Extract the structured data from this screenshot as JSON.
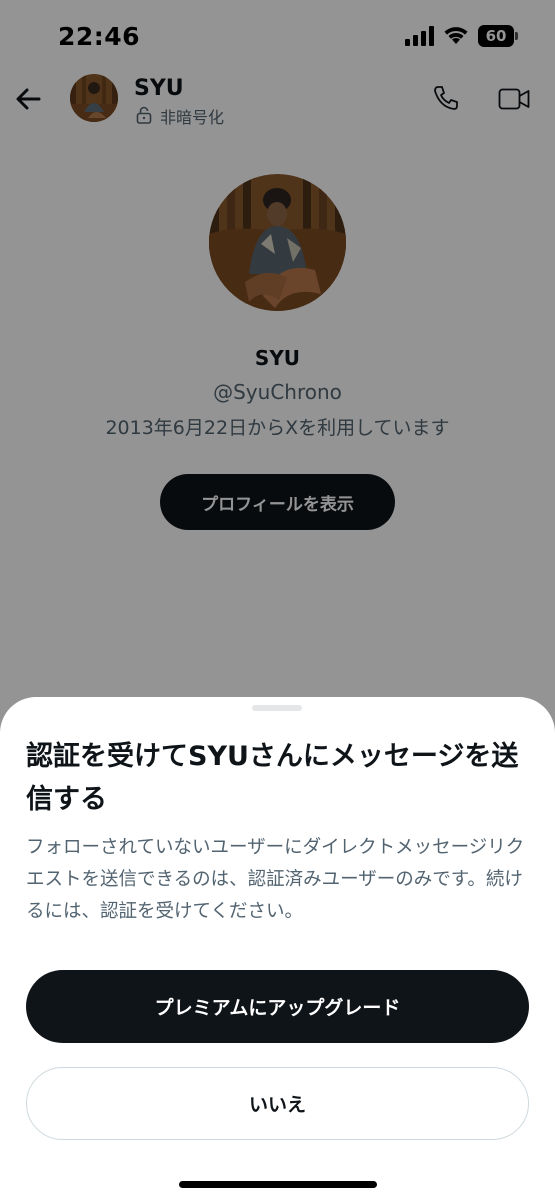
{
  "status_bar": {
    "time": "22:46",
    "battery": "60"
  },
  "header": {
    "name": "SYU",
    "encryption_label": "非暗号化"
  },
  "profile": {
    "name": "SYU",
    "handle": "@SyuChrono",
    "joined": "2013年6月22日からXを利用しています",
    "view_profile_label": "プロフィールを表示"
  },
  "sheet": {
    "title": "認証を受けてSYUさんにメッセージを送信する",
    "body": "フォローされていないユーザーにダイレクトメッセージリクエストを送信できるのは、認証済みユーザーのみです。続けるには、認証を受けてください。",
    "upgrade_label": "プレミアムにアップグレード",
    "no_label": "いいえ"
  },
  "colors": {
    "text_primary": "#0f1419",
    "text_secondary": "#536471",
    "button_dark": "#0f1419",
    "border": "#cfd9de"
  },
  "icons": [
    "back-arrow-icon",
    "lock-icon",
    "phone-icon",
    "video-icon",
    "signal-icon",
    "wifi-icon",
    "battery-icon"
  ]
}
